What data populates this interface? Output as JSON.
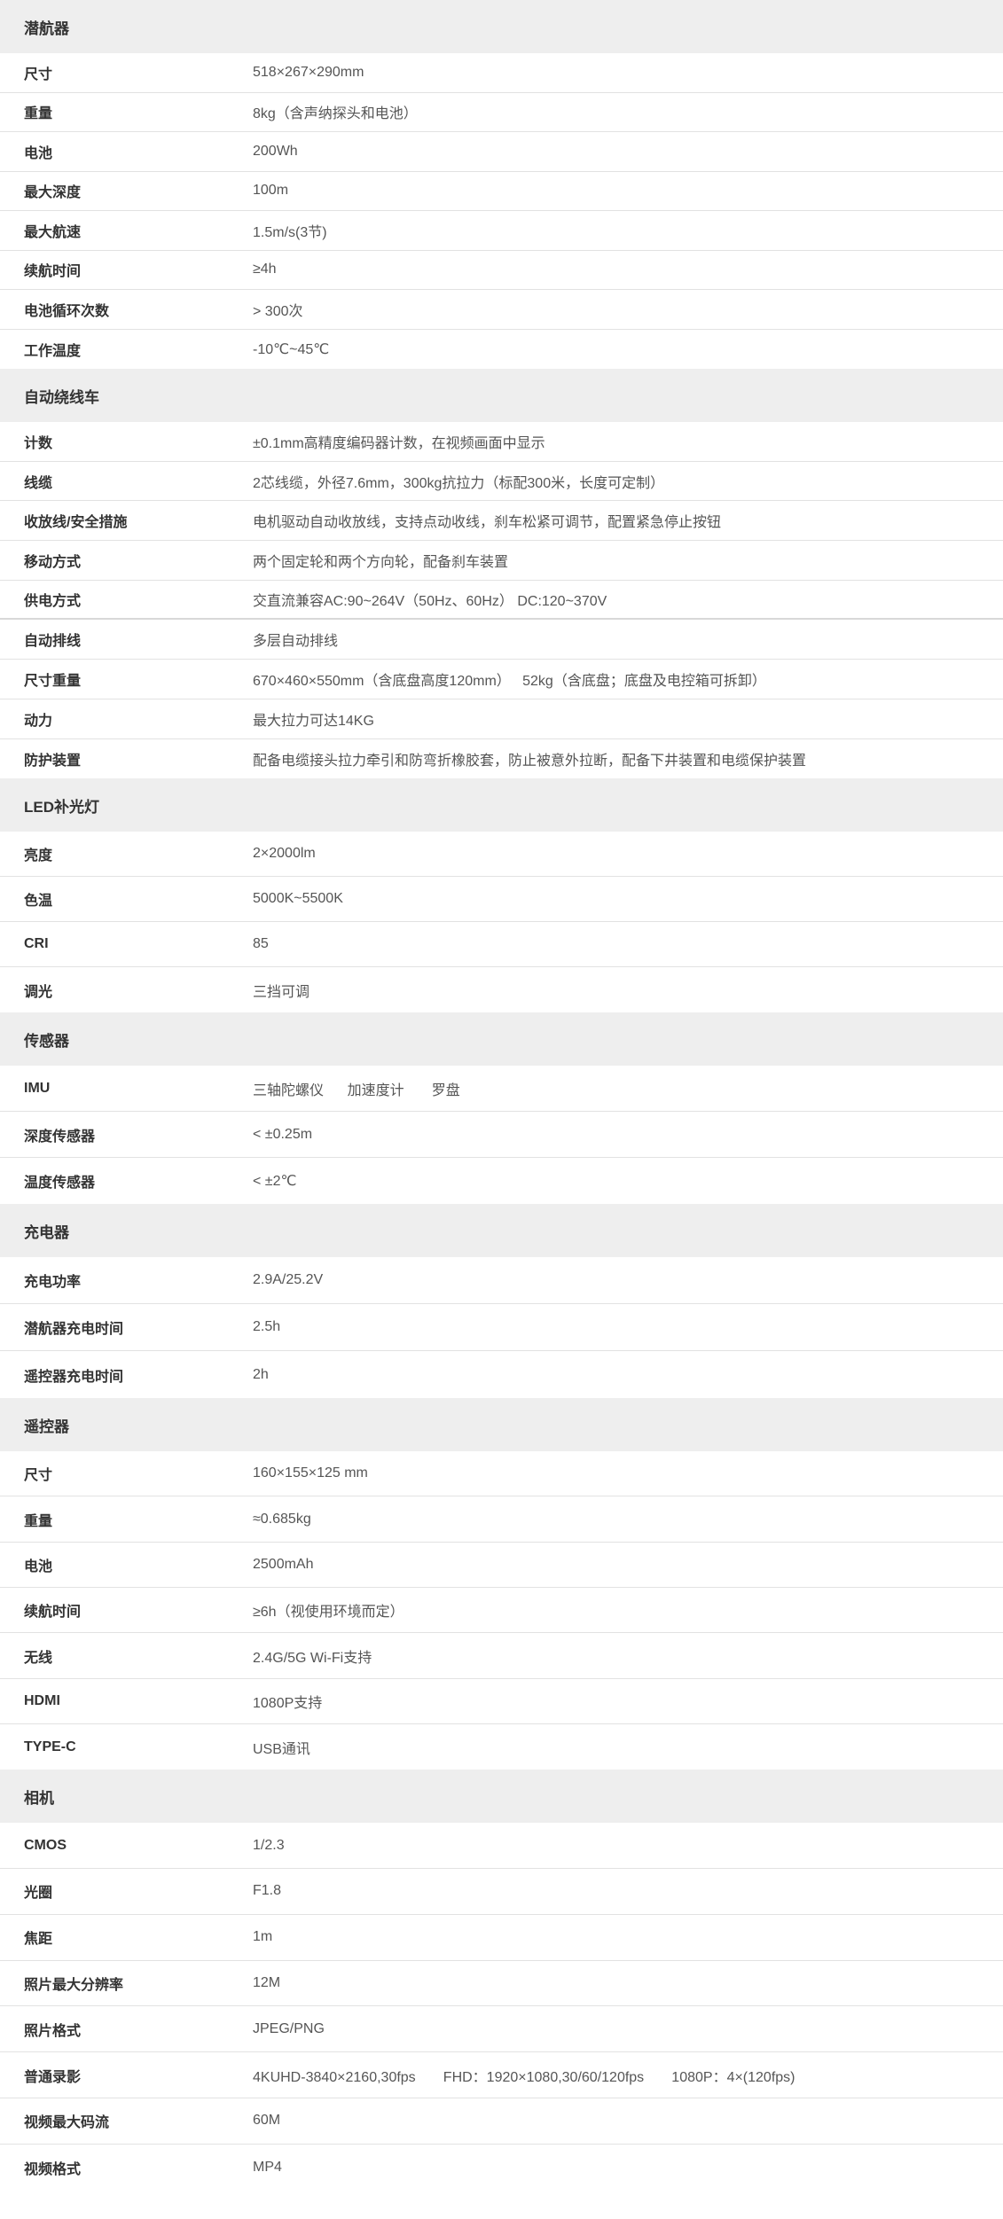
{
  "sections": [
    {
      "title": "潜航器",
      "rows": [
        {
          "label": "尺寸",
          "value": "518×267×290mm"
        },
        {
          "label": "重量",
          "value": "8kg（含声纳探头和电池）"
        },
        {
          "label": "电池",
          "value": "200Wh"
        },
        {
          "label": "最大深度",
          "value": "100m"
        },
        {
          "label": "最大航速",
          "value": "1.5m/s(3节)"
        },
        {
          "label": "续航时间",
          "value": "≥4h"
        },
        {
          "label": "电池循环次数",
          "value": "> 300次"
        },
        {
          "label": "工作温度",
          "value": "-10℃~45℃"
        }
      ]
    },
    {
      "title": "自动绕线车",
      "rows": [
        {
          "label": "计数",
          "value": "±0.1mm高精度编码器计数，在视频画面中显示"
        },
        {
          "label": "线缆",
          "value": "2芯线缆，外径7.6mm，300kg抗拉力（标配300米，长度可定制）"
        },
        {
          "label": "收放线/安全措施",
          "value": "电机驱动自动收放线，支持点动收线，刹车松紧可调节，配置紧急停止按钮"
        },
        {
          "label": "移动方式",
          "value": "两个固定轮和两个方向轮，配备刹车装置"
        },
        {
          "label": "供电方式",
          "value": "交直流兼容AC:90~264V（50Hz、60Hz） DC:120~370V"
        },
        {
          "label": "自动排线",
          "value": "多层自动排线"
        },
        {
          "label": "尺寸重量",
          "value": "670×460×550mm（含底盘高度120mm）   52kg（含底盘；底盘及电控箱可拆卸）"
        },
        {
          "label": "动力",
          "value": "最大拉力可达14KG"
        },
        {
          "label": "防护装置",
          "value": "配备电缆接头拉力牵引和防弯折橡胶套，防止被意外拉断，配备下井装置和电缆保护装置"
        }
      ]
    },
    {
      "title": "LED补光灯",
      "rows": [
        {
          "label": "亮度",
          "value": "2×2000lm"
        },
        {
          "label": "色温",
          "value": "5000K~5500K"
        },
        {
          "label": "CRI",
          "value": "85"
        },
        {
          "label": "调光",
          "value": "三挡可调"
        }
      ]
    },
    {
      "title": "传感器",
      "rows": [
        {
          "label": "IMU",
          "value": "三轴陀螺仪      加速度计       罗盘"
        },
        {
          "label": "深度传感器",
          "value": "< ±0.25m"
        },
        {
          "label": "温度传感器",
          "value": "< ±2℃"
        }
      ]
    },
    {
      "title": "充电器",
      "rows": [
        {
          "label": "充电功率",
          "value": "2.9A/25.2V"
        },
        {
          "label": "潜航器充电时间",
          "value": "2.5h"
        },
        {
          "label": "遥控器充电时间",
          "value": "2h"
        }
      ]
    },
    {
      "title": "遥控器",
      "rows": [
        {
          "label": "尺寸",
          "value": "160×155×125 mm"
        },
        {
          "label": "重量",
          "value": "≈0.685kg"
        },
        {
          "label": "电池",
          "value": "2500mAh"
        },
        {
          "label": "续航时间",
          "value": "≥6h（视使用环境而定）"
        },
        {
          "label": "无线",
          "value": "2.4G/5G Wi-Fi支持"
        },
        {
          "label": "HDMI",
          "value": "1080P支持"
        },
        {
          "label": "TYPE-C",
          "value": "USB通讯"
        }
      ]
    },
    {
      "title": "相机",
      "rows": [
        {
          "label": "CMOS",
          "value": "1/2.3"
        },
        {
          "label": "光圈",
          "value": "F1.8"
        },
        {
          "label": "焦距",
          "value": "1m"
        },
        {
          "label": "照片最大分辨率",
          "value": "12M"
        },
        {
          "label": "照片格式",
          "value": "JPEG/PNG"
        },
        {
          "label": "普通录影",
          "value": "4KUHD-3840×2160,30fps       FHD：1920×1080,30/60/120fps       1080P：4×(120fps)"
        },
        {
          "label": "视频最大码流",
          "value": "60M"
        },
        {
          "label": "视频格式",
          "value": "MP4"
        }
      ]
    }
  ]
}
